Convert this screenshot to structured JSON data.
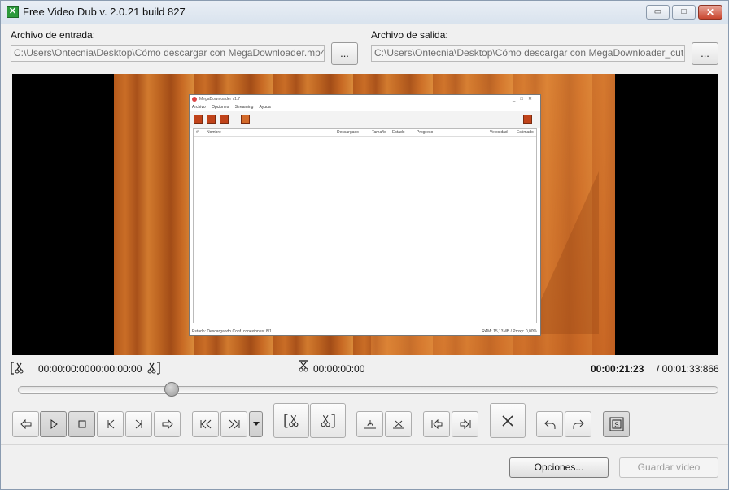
{
  "window": {
    "title": "Free Video Dub  v. 2.0.21 build 827",
    "minimize": "▭",
    "maximize": "□",
    "close": "✕"
  },
  "input": {
    "label": "Archivo de entrada:",
    "value": "C:\\Users\\Ontecnia\\Desktop\\Cómo descargar con MegaDownloader.mp4",
    "browse_label": "..."
  },
  "output": {
    "label": "Archivo de salida:",
    "value": "C:\\Users\\Ontecnia\\Desktop\\Cómo descargar con MegaDownloader_cut.mp4",
    "browse_label": "..."
  },
  "video_content": {
    "app_title": "MegaDownloader v1.7",
    "menu": [
      "Archivo",
      "Opciones",
      "Streaming",
      "Ayuda"
    ],
    "columns": [
      "#",
      "Nombre",
      "Descargado",
      "Tamaño",
      "Estado",
      "Progreso",
      "Velocidad",
      "Estimado"
    ],
    "status_left": "Estado: Descargando    Conf. conexiones: 8/1",
    "status_right": "RAM: 15,13MB / Proxy: 0,00%"
  },
  "timecodes": {
    "start": "00:00:00:00",
    "end": "00:00:00:00",
    "middle": "00:00:00:00",
    "current": "00:00:21:23",
    "total": "/ 00:01:33:866"
  },
  "playback": {
    "position_fraction": 0.219
  },
  "icons": {
    "cut_start": "cut-start-icon",
    "cut_end": "cut-end-icon",
    "cut_marker": "cut-marker-icon"
  },
  "footer": {
    "options_label": "Opciones...",
    "save_label": "Guardar vídeo"
  },
  "colors": {
    "video_bg": "#000000",
    "accent_orange": "#c96d26",
    "disabled_text": "#9c9c9c"
  }
}
